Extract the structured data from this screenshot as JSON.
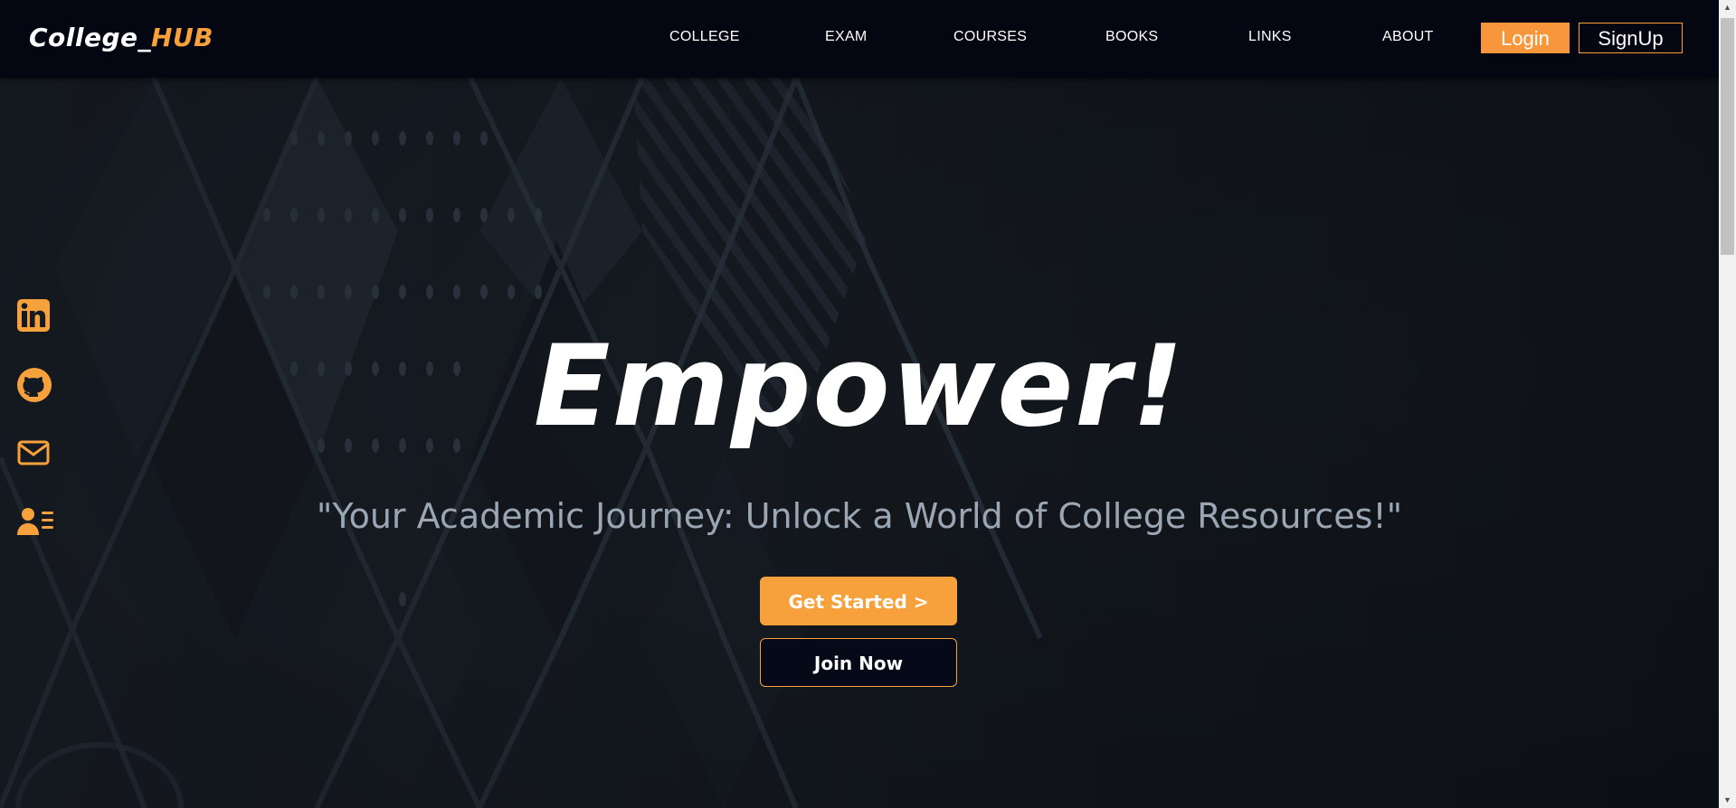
{
  "brand": {
    "logo_main": "College_",
    "logo_accent": "HUB"
  },
  "nav": {
    "links": [
      "COLLEGE",
      "EXAM",
      "COURSES",
      "BOOKS",
      "LINKS",
      "ABOUT"
    ],
    "login_label": "Login",
    "signup_label": "SignUp"
  },
  "social": {
    "icons": [
      "linkedin-icon",
      "github-icon",
      "mail-icon",
      "contact-card-icon"
    ]
  },
  "hero": {
    "headline": "Empower!",
    "subtitle": "\"Your Academic Journey: Unlock a World of College Resources!\"",
    "primary_button": "Get Started >",
    "secondary_button": "Join Now"
  },
  "colors": {
    "accent": "#f7a13c",
    "navbar_bg": "#040712",
    "hero_text": "#ffffff",
    "subtitle_text": "#9aa6b4"
  }
}
